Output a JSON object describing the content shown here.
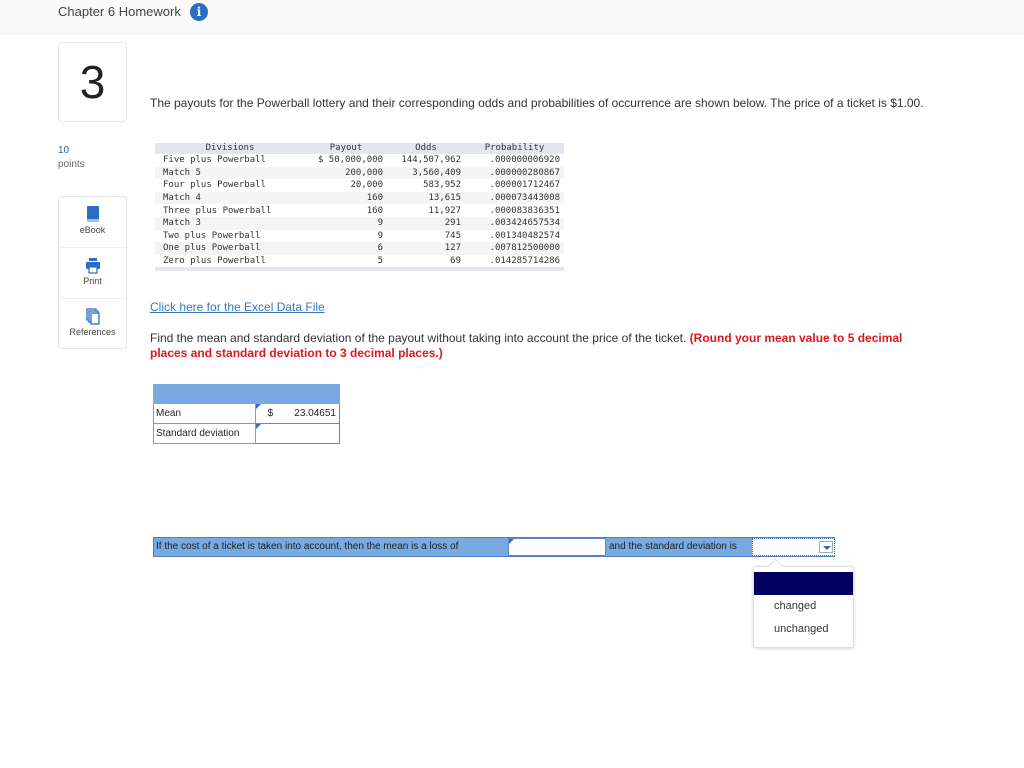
{
  "header": {
    "title": "Chapter 6 Homework",
    "info_icon": "info-icon"
  },
  "question": {
    "number": "3",
    "points_value": "10",
    "points_label": "points"
  },
  "tools": [
    {
      "label": "eBook",
      "icon": "book-icon"
    },
    {
      "label": "Print",
      "icon": "printer-icon"
    },
    {
      "label": "References",
      "icon": "references-icon"
    }
  ],
  "intro_text": "The payouts for the Powerball lottery and their corresponding odds and probabilities of occurrence are shown below. The price of a ticket is $1.00.",
  "table": {
    "headers": [
      "Divisions",
      "Payout",
      "Odds",
      "Probability"
    ],
    "rows": [
      {
        "division": "Five plus Powerball",
        "payout": "$ 50,000,000",
        "odds": "144,507,962",
        "probability": ".000000006920"
      },
      {
        "division": "Match 5",
        "payout": "200,000",
        "odds": "3,560,409",
        "probability": ".000000280867"
      },
      {
        "division": "Four plus Powerball",
        "payout": "20,000",
        "odds": "583,952",
        "probability": ".000001712467"
      },
      {
        "division": "Match 4",
        "payout": "160",
        "odds": "13,615",
        "probability": ".000073443008"
      },
      {
        "division": "Three plus Powerball",
        "payout": "160",
        "odds": "11,927",
        "probability": ".000083836351"
      },
      {
        "division": "Match 3",
        "payout": "9",
        "odds": "291",
        "probability": ".003424657534"
      },
      {
        "division": "Two plus Powerball",
        "payout": "9",
        "odds": "745",
        "probability": ".001340482574"
      },
      {
        "division": "One plus Powerball",
        "payout": "6",
        "odds": "127",
        "probability": ".007812500000"
      },
      {
        "division": "Zero plus Powerball",
        "payout": "5",
        "odds": "69",
        "probability": ".014285714286"
      }
    ]
  },
  "excel_link": "Click here for the Excel Data File",
  "instruction": {
    "text": "Find the mean and standard deviation of the payout without taking into account the price of the ticket. ",
    "emphasis": "(Round your mean value to 5 decimal places and standard deviation to 3 decimal places.)"
  },
  "answer_table": {
    "rows": [
      {
        "label": "Mean",
        "currency": "$",
        "value": "23.04651"
      },
      {
        "label": "Standard deviation",
        "currency": "",
        "value": ""
      }
    ]
  },
  "sentence": {
    "part1": "If the cost of a ticket is taken into account, then the mean is a loss of",
    "input_value": "",
    "part2": "and the standard deviation is",
    "select_value": ""
  },
  "dropdown": {
    "options": [
      "",
      "changed",
      "unchanged"
    ],
    "highlight_color": "#00005e"
  },
  "colors": {
    "accent_blue": "#78a9e0",
    "link": "#3c77b8",
    "emphasis_red": "#e0181b"
  }
}
